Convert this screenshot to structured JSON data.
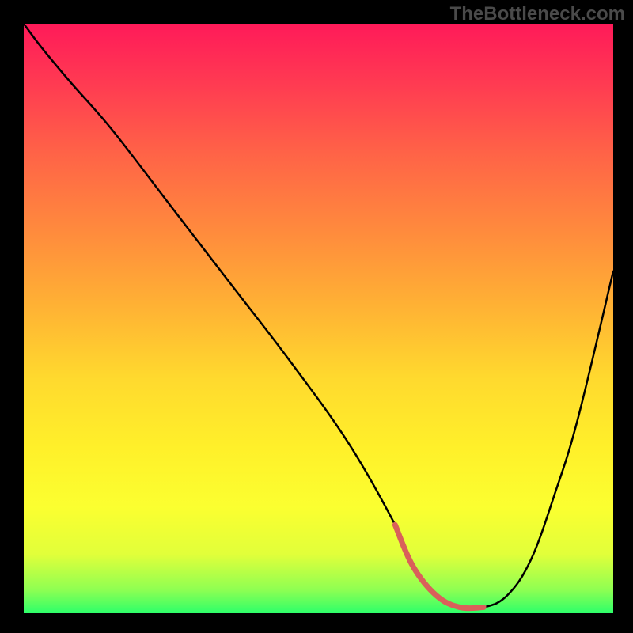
{
  "watermark": "TheBottleneck.com",
  "chart_data": {
    "type": "line",
    "title": "",
    "xlabel": "",
    "ylabel": "",
    "xlim": [
      0,
      100
    ],
    "ylim": [
      0,
      100
    ],
    "series": [
      {
        "name": "curve",
        "x": [
          0,
          3,
          8,
          15,
          25,
          35,
          45,
          55,
          63,
          66,
          70,
          74,
          78,
          82,
          86,
          90,
          94,
          100
        ],
        "y": [
          100,
          96,
          90,
          82,
          69,
          56,
          43,
          29,
          15,
          8,
          3,
          1,
          1,
          3,
          9,
          20,
          33,
          58
        ]
      }
    ],
    "highlight_segment": {
      "x_start": 63,
      "x_end": 80,
      "color": "#d9605a"
    },
    "colors": {
      "background_black": "#000000",
      "gradient_top": "#ff1a59",
      "gradient_bottom": "#2dff6a",
      "curve": "#000000",
      "highlight": "#d9605a"
    }
  }
}
